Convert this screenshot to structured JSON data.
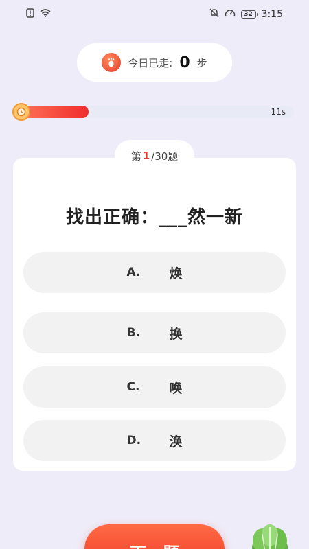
{
  "status_bar": {
    "time": "3:15",
    "battery": "32"
  },
  "steps": {
    "label": "今日已走:",
    "count": "0",
    "unit": "步"
  },
  "timer": {
    "seconds_left": "11s",
    "progress": 0.27
  },
  "quiz": {
    "prefix": "第",
    "current": "1",
    "total": "/30题",
    "question": "找出正确：___然一新",
    "options": [
      {
        "letter": "A.",
        "text": "焕"
      },
      {
        "letter": "B.",
        "text": "换"
      },
      {
        "letter": "C.",
        "text": "唤"
      },
      {
        "letter": "D.",
        "text": "涣"
      }
    ]
  },
  "next_button": {
    "label": "下一题"
  },
  "colors": {
    "accent": "#ef3b2a",
    "background": "#eeecf8"
  }
}
